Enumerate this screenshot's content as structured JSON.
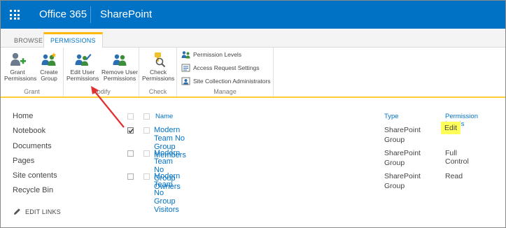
{
  "suite": {
    "app_name": "Office 365",
    "site_name": "SharePoint"
  },
  "ribbon_tabs": [
    {
      "label": "BROWSE",
      "active": false
    },
    {
      "label": "PERMISSIONS",
      "active": true
    }
  ],
  "ribbon": {
    "grant": {
      "label": "Grant",
      "grant_permissions": "Grant\nPermissions",
      "create_group": "Create\nGroup"
    },
    "modify": {
      "label": "Modify",
      "edit_user_permissions": "Edit User\nPermissions",
      "remove_user_permissions": "Remove User\nPermissions"
    },
    "check": {
      "label": "Check",
      "check_permissions": "Check\nPermissions"
    },
    "manage": {
      "label": "Manage",
      "permission_levels": "Permission Levels",
      "access_request_settings": "Access Request Settings",
      "site_collection_administrators": "Site Collection Administrators"
    }
  },
  "quick_launch": {
    "items": [
      "Home",
      "Notebook",
      "Documents",
      "Pages",
      "Site contents",
      "Recycle Bin"
    ],
    "edit_links": "EDIT LINKS"
  },
  "permissions_table": {
    "columns": {
      "name": "Name",
      "type": "Type",
      "permission_levels": "Permission Levels"
    },
    "rows": [
      {
        "name": "Modern Team No Group Members",
        "type": "SharePoint Group",
        "permission_level": "Edit",
        "checked": true,
        "highlighted": true
      },
      {
        "name": "Modern Team No Group Owners",
        "type": "SharePoint Group",
        "permission_level": "Full Control",
        "checked": false,
        "highlighted": false
      },
      {
        "name": "Modern Team No Group Visitors",
        "type": "SharePoint Group",
        "permission_level": "Read",
        "checked": false,
        "highlighted": false
      }
    ]
  },
  "colors": {
    "suite_bar": "#0072c6",
    "accent_underline": "#ffcc33",
    "link": "#0072c6",
    "highlight": "#ffff59",
    "annotation_arrow": "#e03030"
  }
}
